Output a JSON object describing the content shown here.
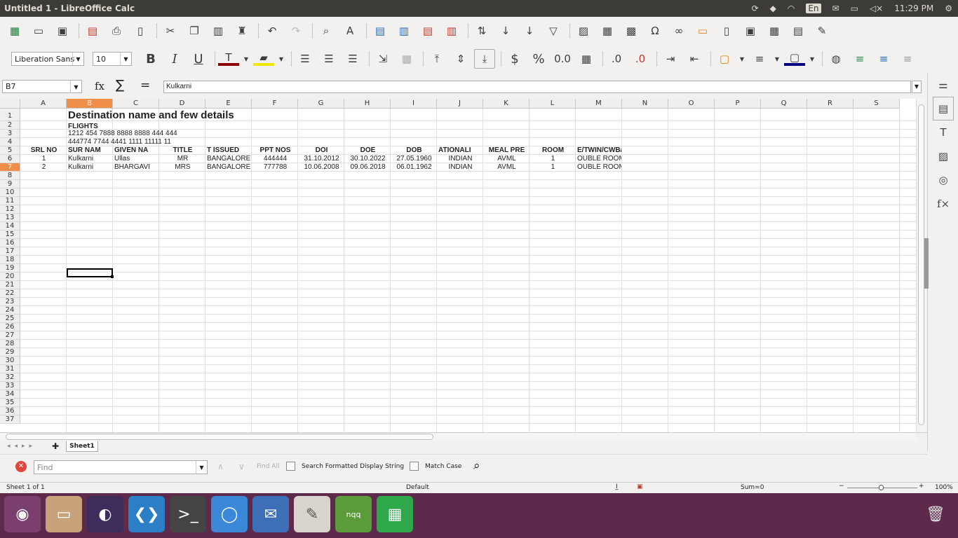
{
  "window": {
    "title": "Untitled 1 - LibreOffice Calc"
  },
  "tray": {
    "lang": "En",
    "time": "11:29 PM"
  },
  "format_toolbar": {
    "font_name": "Liberation Sans",
    "font_size": "10"
  },
  "formula_bar": {
    "name_box": "B7",
    "fx": "fx",
    "sum": "∑",
    "eq": "=",
    "content": "Kulkarni"
  },
  "columns": [
    "A",
    "B",
    "C",
    "D",
    "E",
    "F",
    "G",
    "H",
    "I",
    "J",
    "K",
    "L",
    "M",
    "N",
    "O",
    "P",
    "Q",
    "R",
    "S"
  ],
  "rows": [
    "1",
    "2",
    "3",
    "4",
    "5",
    "6",
    "7",
    "8",
    "9",
    "10",
    "11",
    "12",
    "13",
    "14",
    "15",
    "16",
    "17",
    "18",
    "19",
    "20",
    "21",
    "22",
    "23",
    "24",
    "25",
    "26",
    "27",
    "28",
    "29",
    "30",
    "31",
    "32",
    "33",
    "34",
    "35",
    "36",
    "37"
  ],
  "cells": {
    "title": "Destination name and few details",
    "flights": "FLIGHTS",
    "r3": "1212 454 7888 8888 8888 444 444",
    "r4": "444774 7744 4441  1111 11111 11",
    "headers": [
      "SRL NO",
      "SUR NAM",
      "GIVEN NA",
      "TITLE",
      "T ISSUED",
      "PPT NOS",
      "DOI",
      "DOE",
      "DOB",
      "ATIONALI",
      "MEAL PRE",
      "ROOM",
      "E/TWIN/CWB/CNB"
    ],
    "row6": [
      "1",
      "Kulkarni",
      "Ullas",
      "MR",
      "BANGALORE",
      "444444",
      "31.10.2012",
      "30.10.2022",
      "27.05.1960",
      "INDIAN",
      "AVML",
      "1",
      "OUBLE ROOM"
    ],
    "row7": [
      "2",
      "Kulkarni",
      "BHARGAVI",
      "MRS",
      "BANGALORE",
      "777788",
      "10.06.2008",
      "09.06.2018",
      "06.01.1962",
      "INDIAN",
      "AVML",
      "1",
      "OUBLE ROOM"
    ]
  },
  "sheet_tab": "Sheet1",
  "findbar": {
    "placeholder": "Find",
    "find_all": "Find All",
    "search_formatted": "Search Formatted Display String",
    "match_case": "Match Case"
  },
  "statusbar": {
    "sheet": "Sheet 1 of 1",
    "style": "Default",
    "sum": "Sum=0",
    "zoom": "100%"
  }
}
